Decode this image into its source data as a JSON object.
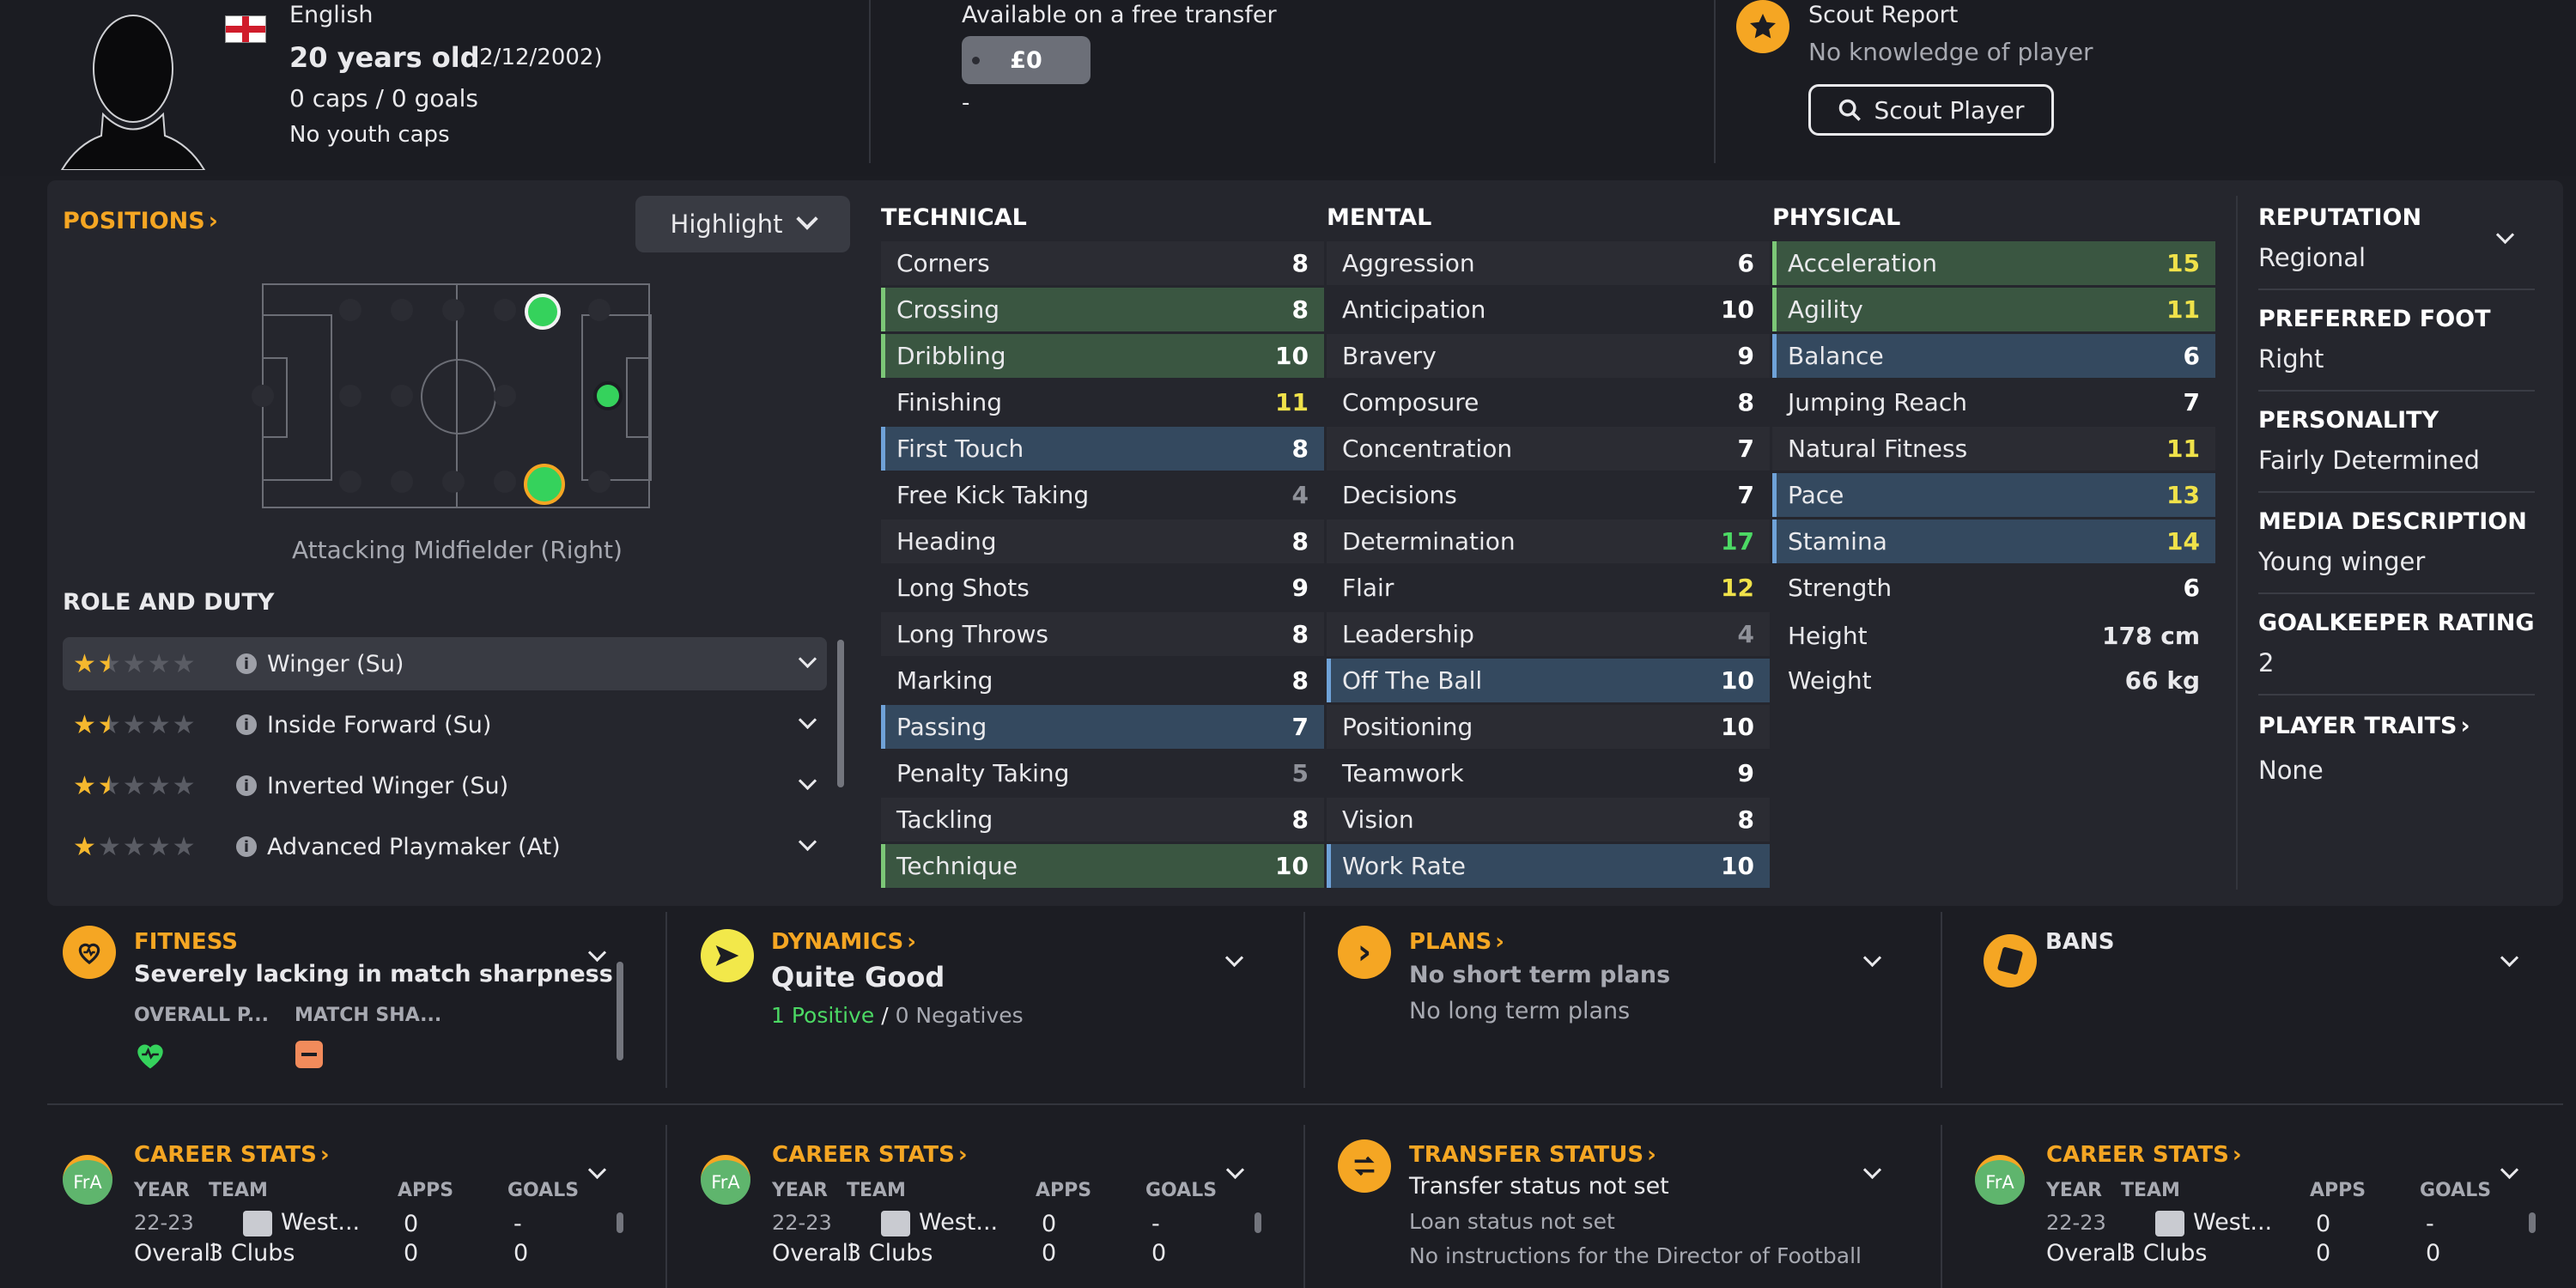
{
  "header": {
    "nationality": "English",
    "age": "20 years old",
    "dob": "(2/12/2002)",
    "caps_goals": "0 caps / 0 goals",
    "youth_caps": "No youth caps",
    "transfer_label": "Available on a free transfer",
    "fee": "£0",
    "fee_sub": "-",
    "scout_title": "Scout Report",
    "scout_sub": "No knowledge of player",
    "scout_button": "Scout Player"
  },
  "positions": {
    "title": "POSITIONS",
    "highlight": "Highlight",
    "position_name": "Attacking Midfielder (Right)"
  },
  "roles": {
    "title": "ROLE AND DUTY",
    "items": [
      {
        "name": "Winger (Su)",
        "stars": 1.5
      },
      {
        "name": "Inside Forward (Su)",
        "stars": 1.5
      },
      {
        "name": "Inverted Winger (Su)",
        "stars": 1.5
      },
      {
        "name": "Advanced Playmaker (At)",
        "stars": 1
      }
    ]
  },
  "technical": {
    "title": "TECHNICAL",
    "rows": [
      {
        "name": "Corners",
        "value": "8"
      },
      {
        "name": "Crossing",
        "value": "8"
      },
      {
        "name": "Dribbling",
        "value": "10"
      },
      {
        "name": "Finishing",
        "value": "11"
      },
      {
        "name": "First Touch",
        "value": "8"
      },
      {
        "name": "Free Kick Taking",
        "value": "4"
      },
      {
        "name": "Heading",
        "value": "8"
      },
      {
        "name": "Long Shots",
        "value": "9"
      },
      {
        "name": "Long Throws",
        "value": "8"
      },
      {
        "name": "Marking",
        "value": "8"
      },
      {
        "name": "Passing",
        "value": "7"
      },
      {
        "name": "Penalty Taking",
        "value": "5"
      },
      {
        "name": "Tackling",
        "value": "8"
      },
      {
        "name": "Technique",
        "value": "10"
      }
    ]
  },
  "mental": {
    "title": "MENTAL",
    "rows": [
      {
        "name": "Aggression",
        "value": "6"
      },
      {
        "name": "Anticipation",
        "value": "10"
      },
      {
        "name": "Bravery",
        "value": "9"
      },
      {
        "name": "Composure",
        "value": "8"
      },
      {
        "name": "Concentration",
        "value": "7"
      },
      {
        "name": "Decisions",
        "value": "7"
      },
      {
        "name": "Determination",
        "value": "17"
      },
      {
        "name": "Flair",
        "value": "12"
      },
      {
        "name": "Leadership",
        "value": "4"
      },
      {
        "name": "Off The Ball",
        "value": "10"
      },
      {
        "name": "Positioning",
        "value": "10"
      },
      {
        "name": "Teamwork",
        "value": "9"
      },
      {
        "name": "Vision",
        "value": "8"
      },
      {
        "name": "Work Rate",
        "value": "10"
      }
    ]
  },
  "physical": {
    "title": "PHYSICAL",
    "rows": [
      {
        "name": "Acceleration",
        "value": "15"
      },
      {
        "name": "Agility",
        "value": "11"
      },
      {
        "name": "Balance",
        "value": "6"
      },
      {
        "name": "Jumping Reach",
        "value": "7"
      },
      {
        "name": "Natural Fitness",
        "value": "11"
      },
      {
        "name": "Pace",
        "value": "13"
      },
      {
        "name": "Stamina",
        "value": "14"
      },
      {
        "name": "Strength",
        "value": "6"
      }
    ],
    "height_label": "Height",
    "height": "178 cm",
    "weight_label": "Weight",
    "weight": "66 kg"
  },
  "info": {
    "reputation_label": "REPUTATION",
    "reputation": "Regional",
    "foot_label": "PREFERRED FOOT",
    "foot": "Right",
    "personality_label": "PERSONALITY",
    "personality": "Fairly Determined",
    "media_label": "MEDIA DESCRIPTION",
    "media": "Young winger",
    "gk_label": "GOALKEEPER RATING",
    "gk": "2",
    "traits_label": "PLAYER TRAITS",
    "traits": "None"
  },
  "fitness": {
    "title": "FITNESS",
    "status": "Severely lacking in match sharpness",
    "col1": "OVERALL P...",
    "col2": "MATCH SHA..."
  },
  "dynamics": {
    "title": "DYNAMICS",
    "status": "Quite Good",
    "positives": "1 Positive",
    "slash": "/",
    "negatives": "0 Negatives"
  },
  "plans": {
    "title": "PLANS",
    "short": "No short term plans",
    "long": "No long term plans"
  },
  "bans": {
    "title": "BANS"
  },
  "career": {
    "title": "CAREER STATS",
    "badge": "FrA",
    "headers": [
      "YEAR",
      "TEAM",
      "APPS",
      "GOALS"
    ],
    "row1": {
      "year": "22-23",
      "team": "West...",
      "apps": "0",
      "goals": "-"
    },
    "row2": {
      "year": "Overall",
      "team": "3 Clubs",
      "apps": "0",
      "goals": "0"
    }
  },
  "transfer_status": {
    "title": "TRANSFER STATUS",
    "status": "Transfer status not set",
    "loan": "Loan status not set",
    "instructions": "No instructions for the Director of Football"
  },
  "colors": {
    "accent": "#f5a623",
    "green": "#35d25c",
    "highlight_blue": "#34495f",
    "highlight_green": "#3a5641"
  }
}
